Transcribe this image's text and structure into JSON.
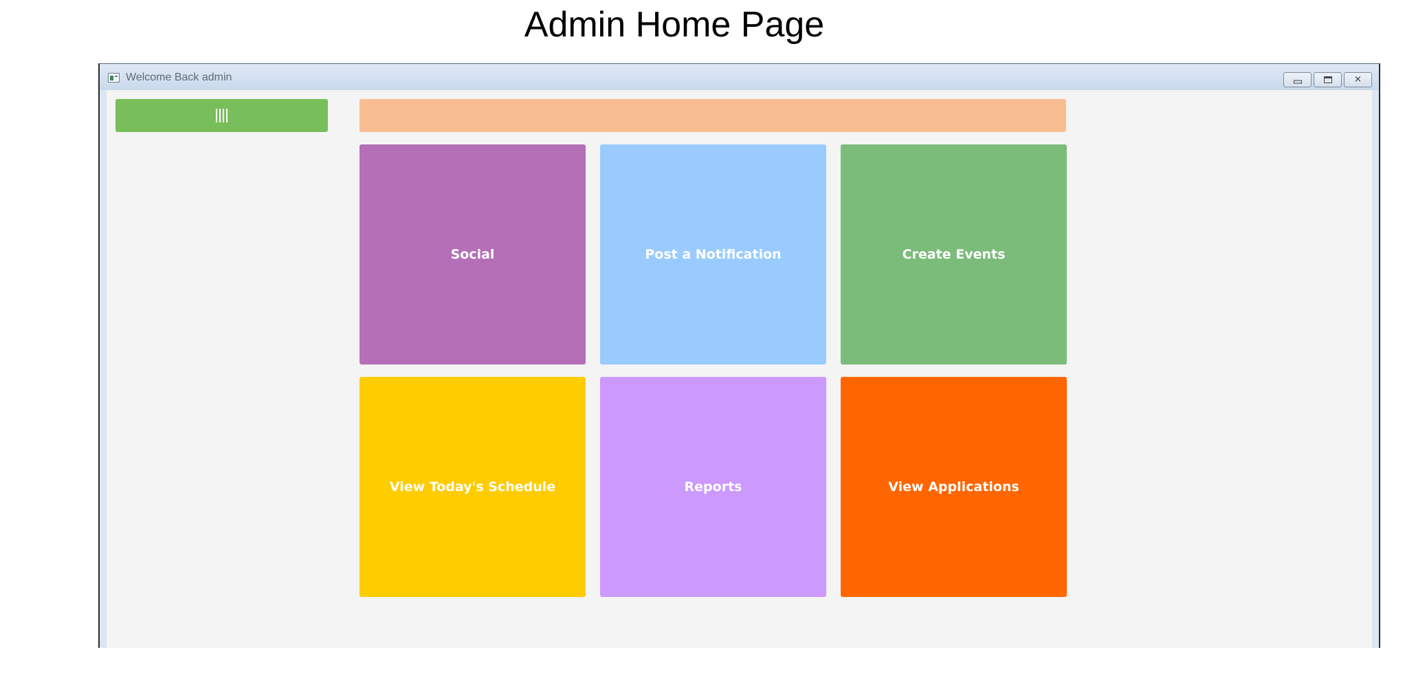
{
  "page": {
    "title": "Admin Home Page"
  },
  "window": {
    "title": "Welcome Back admin",
    "controls": {
      "minimize_icon": "minimize-icon",
      "maximize_icon": "maximize-icon",
      "close_icon": "close-icon"
    }
  },
  "sidebar": {
    "menu_icon": "hamburger-icon",
    "menu_color": "#78be5a"
  },
  "header": {
    "color": "#f9bd92"
  },
  "tiles": [
    {
      "label": "Social",
      "color": "#b56fb7"
    },
    {
      "label": "Post a Notification",
      "color": "#99cbff"
    },
    {
      "label": "Create Events",
      "color": "#7bbc7b"
    },
    {
      "label": "View Today's Schedule",
      "color": "#ffcc00"
    },
    {
      "label": "Reports",
      "color": "#cc99ff"
    },
    {
      "label": "View Applications",
      "color": "#ff6600"
    }
  ]
}
